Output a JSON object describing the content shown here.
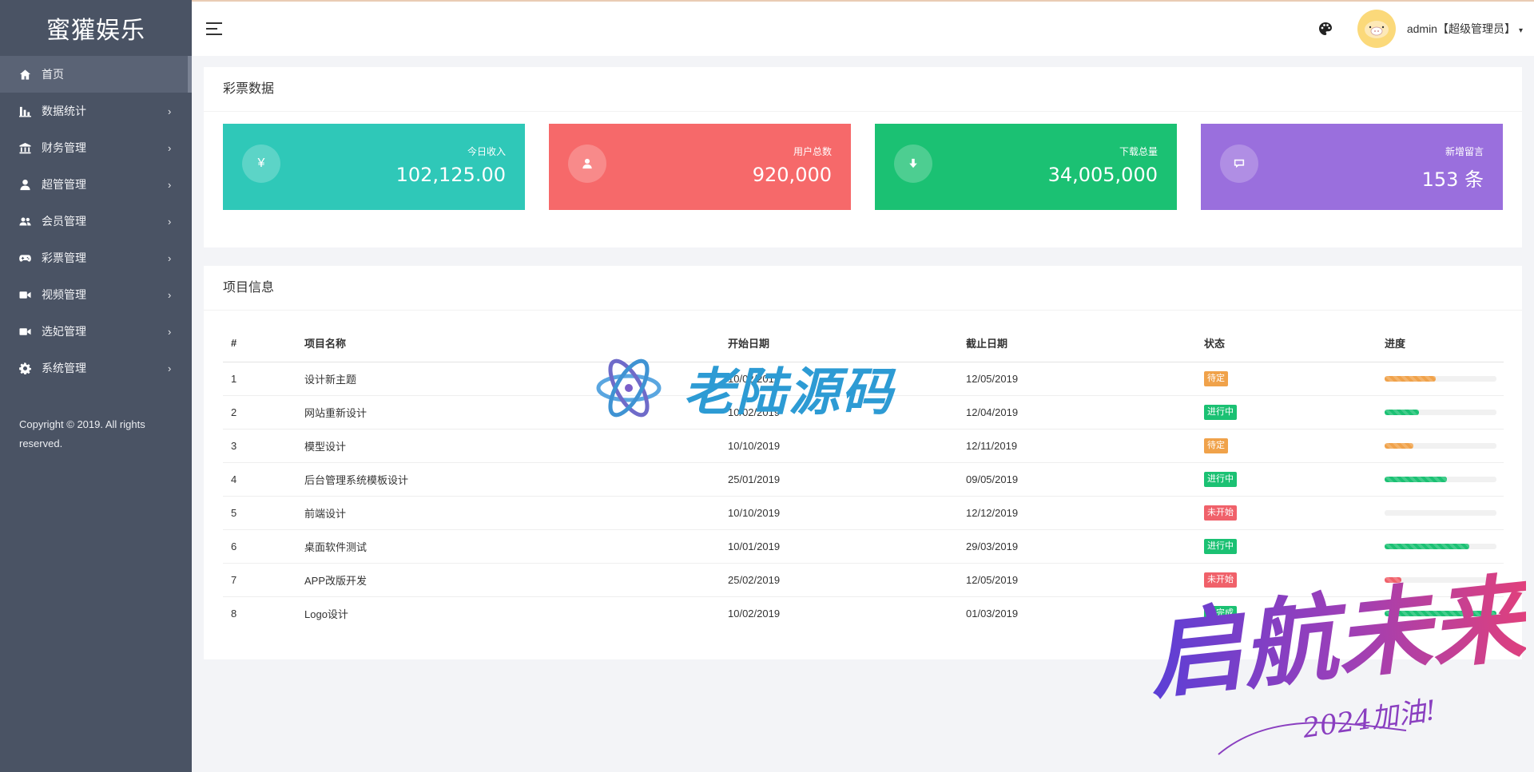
{
  "brand": "蜜獾娱乐",
  "colors": {
    "sidebar": "#4a5364",
    "teal": "#2fc8b8",
    "red": "#f6696a",
    "green": "#1bc173",
    "purple": "#9a6fdd",
    "badge_orange": "#f0a24a",
    "badge_green": "#1bc173",
    "badge_red": "#f0616a"
  },
  "sidebar": {
    "items": [
      {
        "label": "首页",
        "icon": "home-icon"
      },
      {
        "label": "数据统计",
        "icon": "bar-chart-icon"
      },
      {
        "label": "财务管理",
        "icon": "bank-icon"
      },
      {
        "label": "超管管理",
        "icon": "user-icon"
      },
      {
        "label": "会员管理",
        "icon": "users-icon"
      },
      {
        "label": "彩票管理",
        "icon": "gamepad-icon"
      },
      {
        "label": "视频管理",
        "icon": "video-icon"
      },
      {
        "label": "选妃管理",
        "icon": "video-icon"
      },
      {
        "label": "系统管理",
        "icon": "gear-icon"
      }
    ],
    "arrow": "›",
    "copyright": "Copyright © 2019. All rights reserved."
  },
  "header": {
    "user": "admin【超级管理员】",
    "caret": "▾"
  },
  "lottery": {
    "title": "彩票数据",
    "stats": [
      {
        "label": "今日收入",
        "value": "102,125.00",
        "icon": "yen-icon",
        "glyph": "¥"
      },
      {
        "label": "用户总数",
        "value": "920,000",
        "icon": "user-icon"
      },
      {
        "label": "下载总量",
        "value": "34,005,000",
        "icon": "download-icon"
      },
      {
        "label": "新增留言",
        "value": "153 条",
        "icon": "message-icon"
      }
    ]
  },
  "projects": {
    "title": "项目信息",
    "headers": [
      "#",
      "项目名称",
      "开始日期",
      "截止日期",
      "状态",
      "进度"
    ],
    "rows": [
      {
        "no": "1",
        "name": "设计新主题",
        "start": "10/02/2019",
        "end": "12/05/2019",
        "status": "待定",
        "status_type": "orange",
        "progress": 0.46
      },
      {
        "no": "2",
        "name": "网站重新设计",
        "start": "10/02/2019",
        "end": "12/04/2019",
        "status": "进行中",
        "status_type": "green",
        "progress": 0.31
      },
      {
        "no": "3",
        "name": "模型设计",
        "start": "10/10/2019",
        "end": "12/11/2019",
        "status": "待定",
        "status_type": "orange",
        "progress": 0.26
      },
      {
        "no": "4",
        "name": "后台管理系统模板设计",
        "start": "25/01/2019",
        "end": "09/05/2019",
        "status": "进行中",
        "status_type": "green",
        "progress": 0.56
      },
      {
        "no": "5",
        "name": "前端设计",
        "start": "10/10/2019",
        "end": "12/12/2019",
        "status": "未开始",
        "status_type": "red",
        "progress": 0.0
      },
      {
        "no": "6",
        "name": "桌面软件测试",
        "start": "10/01/2019",
        "end": "29/03/2019",
        "status": "进行中",
        "status_type": "green",
        "progress": 0.76
      },
      {
        "no": "7",
        "name": "APP改版开发",
        "start": "25/02/2019",
        "end": "12/05/2019",
        "status": "未开始",
        "status_type": "red",
        "progress": 0.15
      },
      {
        "no": "8",
        "name": "Logo设计",
        "start": "10/02/2019",
        "end": "01/03/2019",
        "status": "已完成",
        "status_type": "green",
        "progress": 1.0
      }
    ]
  },
  "watermarks": {
    "primary": "老陆源码",
    "secondary": "启航未来",
    "tagline": "2024加油!"
  }
}
